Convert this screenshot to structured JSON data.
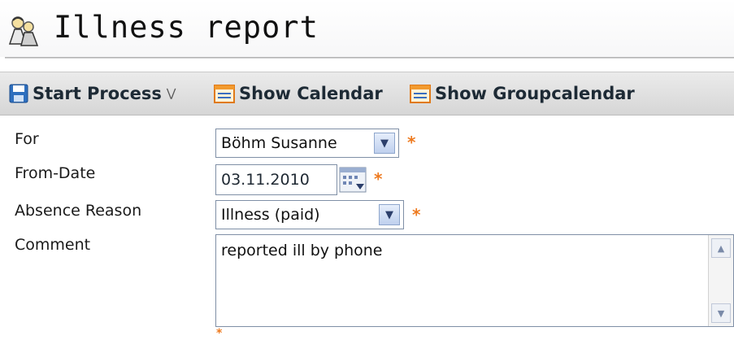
{
  "header": {
    "title": "Illness report",
    "icon": "people-icon"
  },
  "toolbar": {
    "start_process": "Start Process",
    "show_calendar": "Show Calendar",
    "show_groupcalendar": "Show Groupcalendar"
  },
  "form": {
    "for_label": "For",
    "for_value": "Böhm Susanne",
    "from_date_label": "From-Date",
    "from_date_value": "03.11.2010",
    "absence_reason_label": "Absence Reason",
    "absence_reason_value": "Illness (paid)",
    "comment_label": "Comment",
    "comment_value": "reported ill by phone",
    "required_marker": "*"
  },
  "colors": {
    "required": "#ee7a1f",
    "toolbar_bg": "#dcdcdc",
    "field_border": "#7f8fa6"
  }
}
